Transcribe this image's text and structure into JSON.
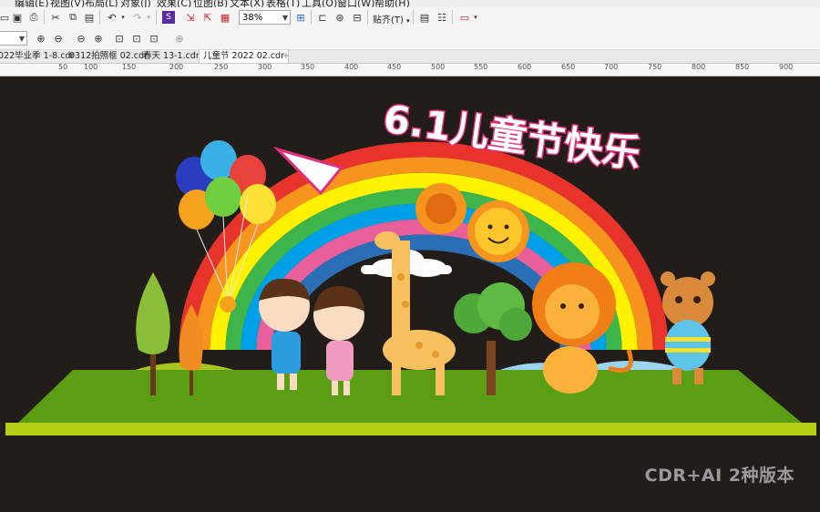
{
  "menu": [
    "编辑(E)",
    "视图(V)",
    "布局(L)",
    "对象(J)",
    "效果(C)",
    "位图(B)",
    "文本(X)",
    "表格(T)",
    "工具(O)",
    "窗口(W)",
    "帮助(H)"
  ],
  "toolbar": {
    "zoom_value": "38%",
    "snap_label": "贴齐(T)"
  },
  "tabs": [
    {
      "label": "022毕业季 1-8.cdr",
      "active": false
    },
    {
      "label": "0312拍照框 02.cdr",
      "active": false
    },
    {
      "label": "春天 13-1.cdr",
      "active": false
    },
    {
      "label": "儿童节 2022 02.cdr",
      "active": true
    }
  ],
  "add_tab_label": "+",
  "ruler_numbers": [
    "50",
    "100",
    "150",
    "200",
    "250",
    "300",
    "350",
    "400",
    "450",
    "500",
    "550",
    "600",
    "650",
    "700",
    "750",
    "800",
    "850",
    "900"
  ],
  "artwork": {
    "title": "6.1儿童节快乐"
  },
  "watermark": "CDR+AI 2种版本",
  "colors": {
    "canvas_bg": "#231d1a",
    "grass": "#5a9e14",
    "rainbow": [
      "#e8332a",
      "#f7941d",
      "#fff200",
      "#3db54a",
      "#00a0e9",
      "#e85f9a",
      "#2a6fb5"
    ]
  }
}
